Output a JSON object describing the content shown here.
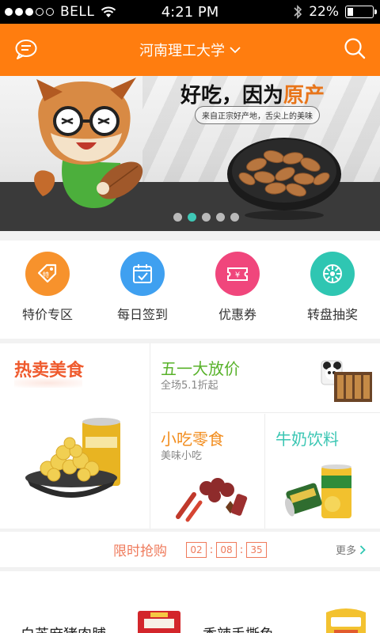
{
  "status_bar": {
    "carrier": "BELL",
    "time": "4:21 PM",
    "battery_text": "22%",
    "battery_level": 0.22,
    "signal_bars_full": 3,
    "signal_bars_total": 5
  },
  "header": {
    "title": "河南理工大学"
  },
  "banner": {
    "headline_prefix": "好吃，因为",
    "headline_highlight": "原产",
    "subtitle": "来自正宗好产地，舌尖上的美味",
    "page_count": 5,
    "active_page": 2
  },
  "quick_nav": [
    {
      "label": "特价专区",
      "icon": "price-tag-icon",
      "color": "#f7922c"
    },
    {
      "label": "每日签到",
      "icon": "calendar-check-icon",
      "color": "#3fa0f0"
    },
    {
      "label": "优惠券",
      "icon": "coupon-icon",
      "color": "#f0467c"
    },
    {
      "label": "转盘抽奖",
      "icon": "lottery-wheel-icon",
      "color": "#2fc6b2"
    }
  ],
  "categories": {
    "hot": {
      "title": "热卖美食"
    },
    "may_day": {
      "title": "五一大放价",
      "subtitle": "全场5.1折起"
    },
    "snacks": {
      "title": "小吃零食",
      "subtitle": "美味小吃"
    },
    "drinks": {
      "title": "牛奶饮料"
    }
  },
  "flash_sale": {
    "title": "限时抢购",
    "hours": "02",
    "minutes": "08",
    "seconds": "35",
    "more": "更多"
  },
  "products": [
    {
      "name": "白芝麻猪肉脯"
    },
    {
      "name": "香辣手撕鱼"
    }
  ],
  "colors": {
    "brand": "#ff7d0f",
    "accent_teal": "#3fc8b6",
    "flash": "#ef7a5b"
  }
}
